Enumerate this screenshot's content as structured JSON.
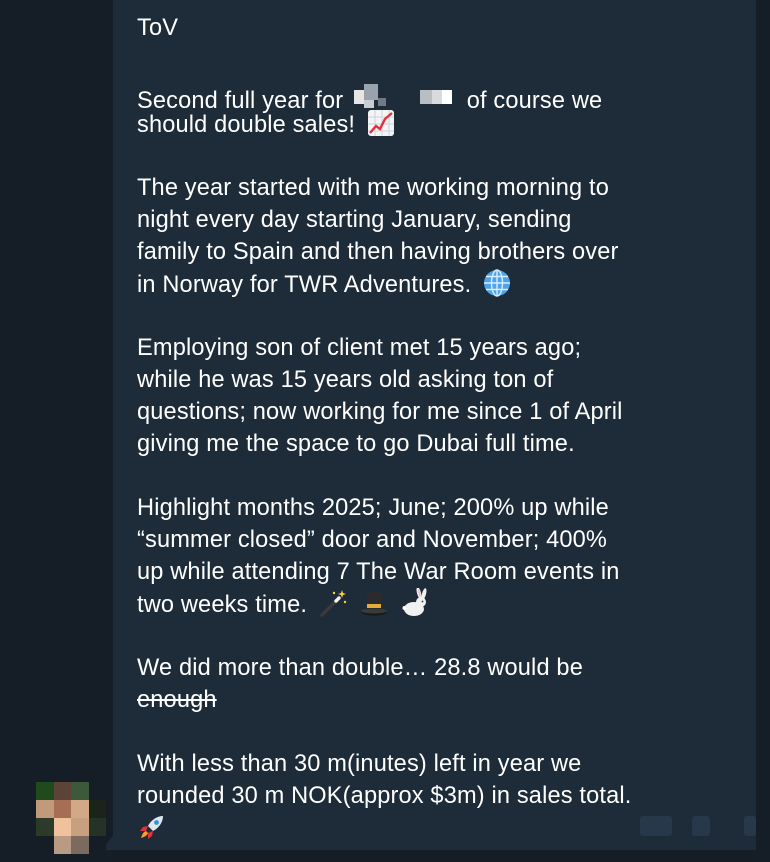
{
  "message": {
    "heading": "ToV",
    "p1_l1_before": "Second full year for",
    "p1_l1_after": "of course we",
    "p1_l2": "should double sales!",
    "p2_l1": "The year started with me working morning to",
    "p2_l2": "night every day starting January, sending",
    "p2_l3": "family to Spain and then having brothers over",
    "p2_l4": "in Norway for TWR Adventures.",
    "p3_l1": "Employing son of client met 15 years ago;",
    "p3_l2": "while he was 15 years old asking ton of",
    "p3_l3": "questions; now working for me since 1 of April",
    "p3_l4": "giving me the space to go Dubai full time.",
    "p4_l1": "Highlight months 2025; June; 200% up while",
    "p4_l2": "“summer closed” door and November; 400%",
    "p4_l3": "up while attending 7 The War Room events in",
    "p4_l4": "two weeks time.",
    "p5_l1": "We did more than double… 28.8 would be",
    "p5_l2_struck": "enough",
    "p6_l1": "With less than 30 m(inutes) left in year we",
    "p6_l2": "rounded 30 m NOK(approx $3m) in sales total."
  },
  "icons": {
    "chart": "chart-increasing-icon",
    "globe": "globe-icon",
    "wand": "magic-wand-icon",
    "hat": "top-hat-icon",
    "rabbit": "rabbit-icon",
    "rocket": "rocket-icon"
  },
  "colors": {
    "background": "#151e27",
    "bubble": "#1e2c3a",
    "text": "#ffffff"
  }
}
